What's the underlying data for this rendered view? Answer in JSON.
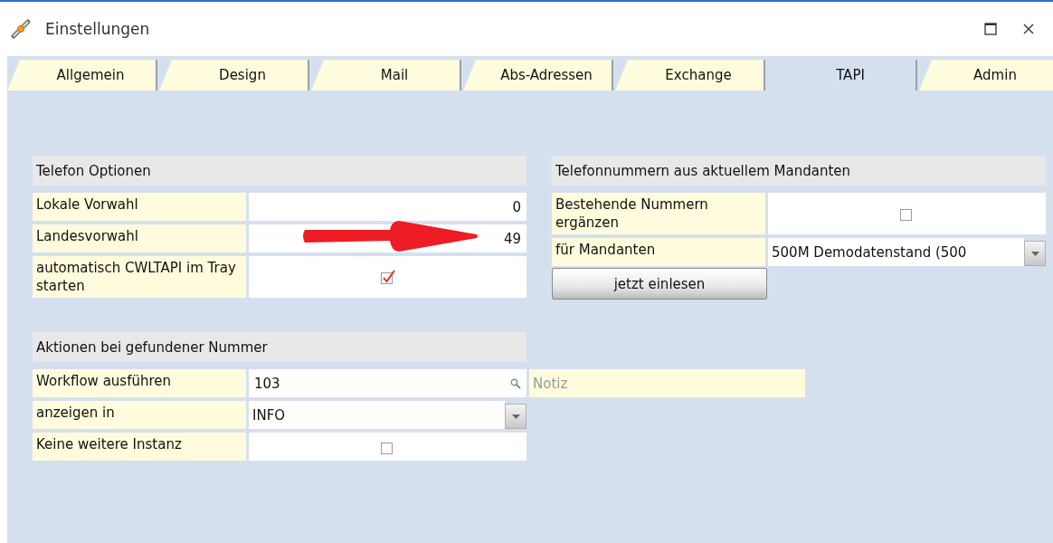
{
  "window": {
    "title": "Einstellungen"
  },
  "tabs": [
    {
      "label": "Allgemein",
      "selected": false
    },
    {
      "label": "Design",
      "selected": false
    },
    {
      "label": "Mail",
      "selected": false
    },
    {
      "label": "Abs-Adressen",
      "selected": false
    },
    {
      "label": "Exchange",
      "selected": false
    },
    {
      "label": "TAPI",
      "selected": true
    },
    {
      "label": "Admin",
      "selected": false
    }
  ],
  "sections": [
    {
      "title": "Telefon Optionen",
      "rows": [
        {
          "kind": "number",
          "label": "Lokale Vorwahl",
          "value": "0"
        },
        {
          "kind": "number",
          "label": "Landesvorwahl",
          "value": "49"
        },
        {
          "kind": "checkbox",
          "label": "automatisch CWLTAPI im Tray starten",
          "checked": true
        }
      ]
    },
    {
      "title": "Telefonnummern aus aktuellem Mandanten",
      "rows": [
        {
          "kind": "checkbox",
          "label": "Bestehende Nummern ergänzen",
          "checked": false
        },
        {
          "kind": "select",
          "label": "für Mandanten",
          "value": "500M Demodatenstand (500"
        }
      ],
      "button": "jetzt einlesen"
    },
    {
      "title": "Aktionen bei gefundener Nummer",
      "rows": [
        {
          "kind": "lookup",
          "label": "Workflow ausführen",
          "value": "103",
          "note_placeholder": "Notiz"
        },
        {
          "kind": "select",
          "label": "anzeigen in",
          "value": "INFO"
        },
        {
          "kind": "checkbox",
          "label": "Keine weitere Instanz",
          "checked": false
        }
      ]
    }
  ],
  "annotations": [
    {
      "kind": "arrow"
    }
  ]
}
